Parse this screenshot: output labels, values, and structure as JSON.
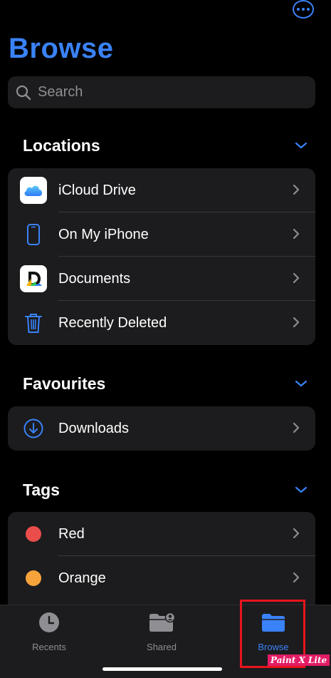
{
  "header": {
    "title": "Browse"
  },
  "search": {
    "placeholder": "Search"
  },
  "sections": {
    "locations": {
      "label": "Locations"
    },
    "favourites": {
      "label": "Favourites"
    },
    "tags": {
      "label": "Tags"
    }
  },
  "locations": [
    {
      "label": "iCloud Drive",
      "icon": "icloud-icon"
    },
    {
      "label": "On My iPhone",
      "icon": "iphone-icon"
    },
    {
      "label": "Documents",
      "icon": "documents-app-icon"
    },
    {
      "label": "Recently Deleted",
      "icon": "trash-icon"
    }
  ],
  "favourites": [
    {
      "label": "Downloads",
      "icon": "download-icon"
    }
  ],
  "tags": [
    {
      "label": "Red",
      "color": "#eb4d4b"
    },
    {
      "label": "Orange",
      "color": "#f5a33a"
    }
  ],
  "tabbar": {
    "tabs": [
      {
        "label": "Recents",
        "icon": "clock-icon",
        "active": false
      },
      {
        "label": "Shared",
        "icon": "shared-folder-icon",
        "active": false
      },
      {
        "label": "Browse",
        "icon": "folder-icon",
        "active": true
      }
    ]
  },
  "watermark": {
    "text": "Paint X Lite"
  },
  "colors": {
    "accent": "#3a82f7",
    "background": "#000000",
    "cell": "#1c1c1e",
    "highlight": "#e8141c"
  }
}
